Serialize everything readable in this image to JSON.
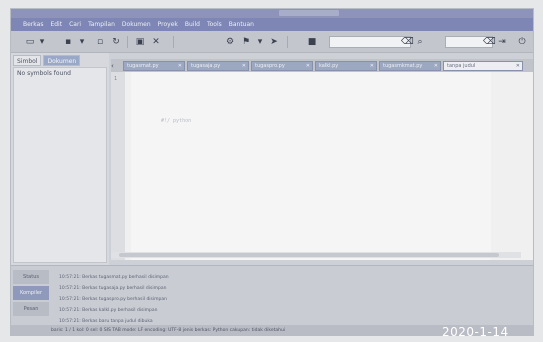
{
  "menu": [
    "Berkas",
    "Edit",
    "Cari",
    "Tampilan",
    "Dokumen",
    "Proyek",
    "Build",
    "Tools",
    "Bantuan"
  ],
  "toolbar": {
    "search_placeholder": "",
    "goto_placeholder": ""
  },
  "sidebar": {
    "tabs": [
      "Simbol",
      "Dokumen"
    ],
    "active_tab": 0,
    "message": "No symbols found"
  },
  "editor_tabs": [
    {
      "label": "tugasmat.py"
    },
    {
      "label": "tugasaja.py"
    },
    {
      "label": "tugaspro.py"
    },
    {
      "label": "kalkl.py"
    },
    {
      "label": "tugasmkmat.py"
    },
    {
      "label": "tanpa judul",
      "active": true
    }
  ],
  "editor": {
    "line_number": "1",
    "code_line": "#!/ python"
  },
  "bottom_panel": {
    "tabs": [
      "Status",
      "Kompiler",
      "Pesan"
    ],
    "active_tab": 1,
    "log_lines": [
      "10:57:21: Berkas tugasmat.py berhasil disimpan",
      "10:57:21: Berkas tugasaja.py berhasil disimpan",
      "10:57:21: Berkas tugaspro.py berhasil disimpan",
      "10:57:21: Berkas kalkl.py berhasil disimpan",
      "10:57:21: Berkas baru tanpa judul dibuka"
    ]
  },
  "statusbar": {
    "text": "baris: 1 / 1   kol: 0   sel: 0   SIS   TAB   mode: LF   encoding: UTF-8   jenis berkas: Python   cakupan: tidak diketahui"
  },
  "overlay": {
    "timestamp": "2020-1-14"
  }
}
